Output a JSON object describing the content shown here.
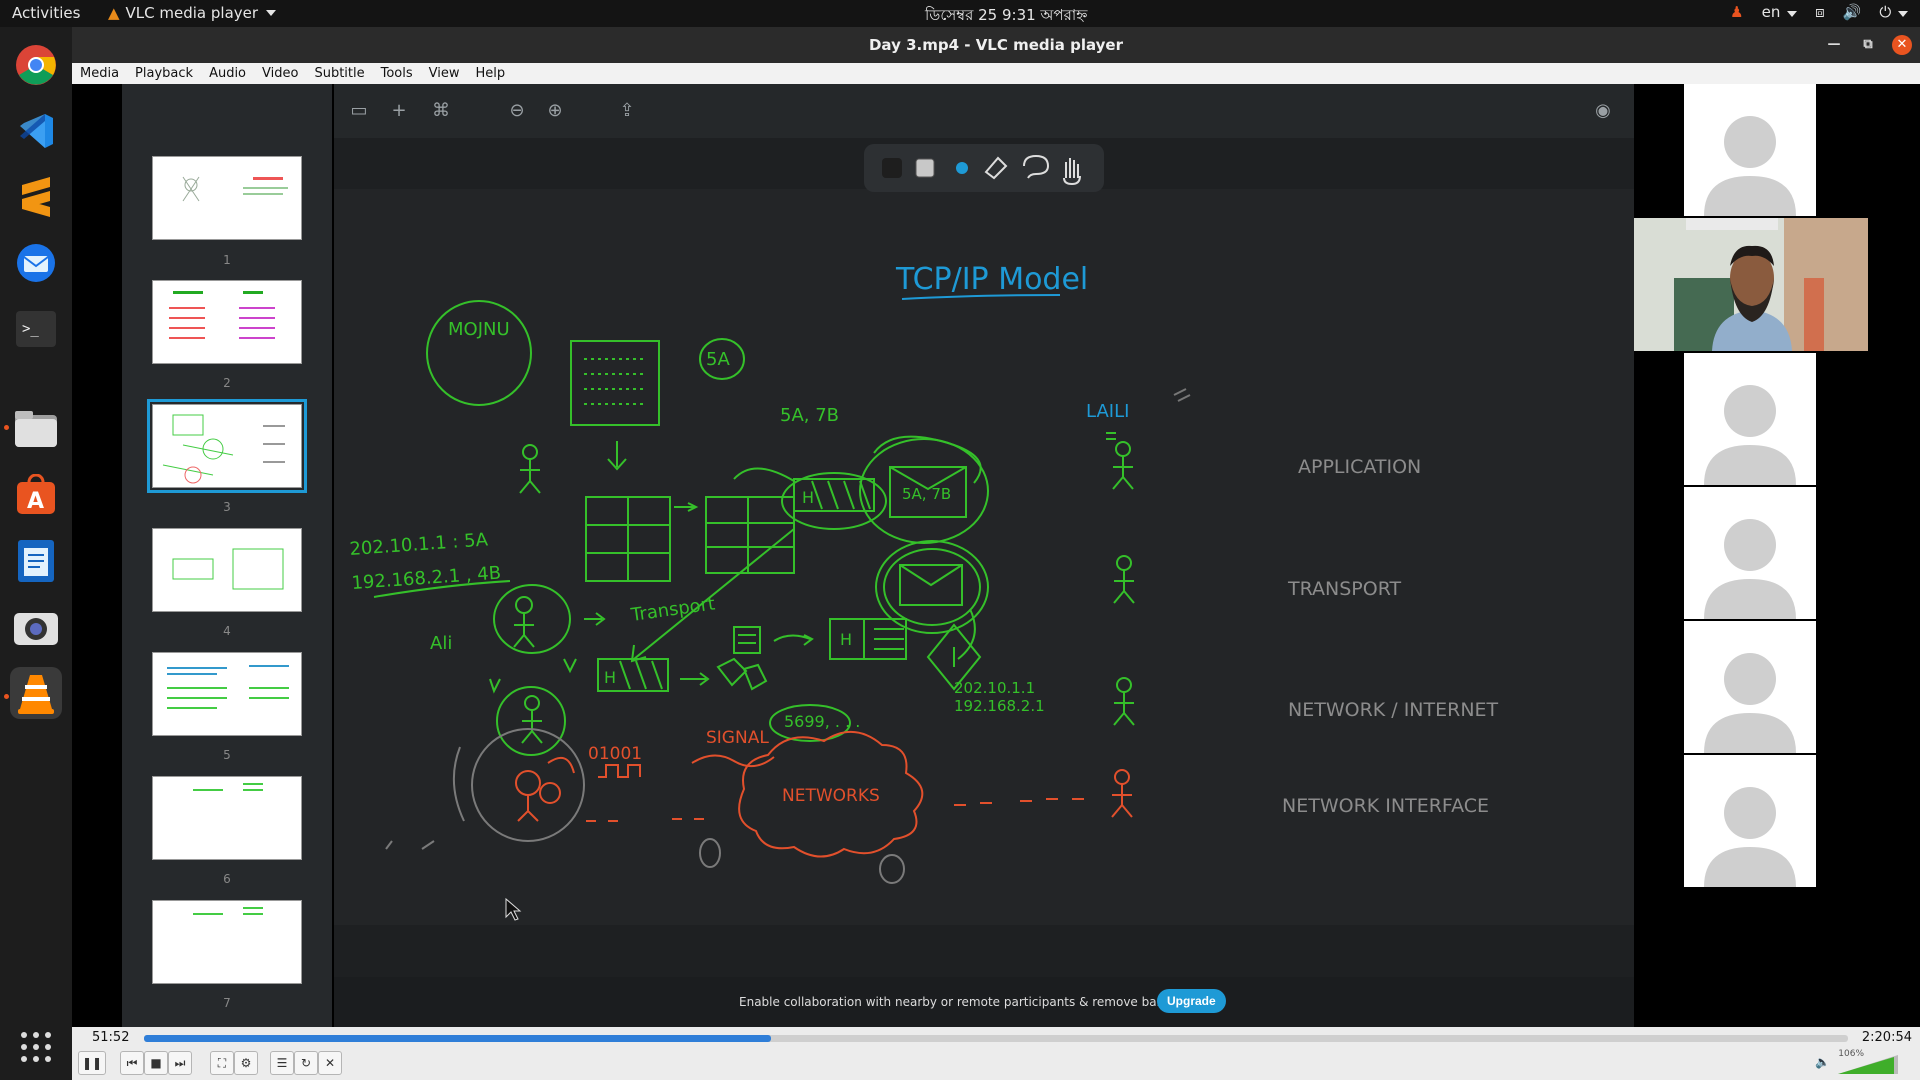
{
  "topbar": {
    "activities": "Activities",
    "app_name": "VLC media player",
    "clock": "ডিসেম্বর 25  9:31 অপরাহ্ন",
    "lang": "en"
  },
  "window": {
    "title": "Day 3.mp4 - VLC media player"
  },
  "menubar": [
    "Media",
    "Playback",
    "Audio",
    "Video",
    "Subtitle",
    "Tools",
    "View",
    "Help"
  ],
  "dock": {
    "items": [
      "chrome-icon",
      "vscode-icon",
      "sublime-icon",
      "thunderbird-icon",
      "terminal-icon",
      "files-icon",
      "software-icon",
      "writer-icon",
      "camera-icon",
      "vlc-icon",
      "app-grid-icon"
    ]
  },
  "slides": {
    "numbers": [
      "1",
      "2",
      "3",
      "4",
      "5",
      "6",
      "7"
    ],
    "selected_index": 2
  },
  "whiteboard": {
    "title": "TCP/IP Model",
    "names": {
      "left": "MOJNU",
      "right": "LAILI",
      "ali": "Ali"
    },
    "layers": [
      "APPLICATION",
      "TRANSPORT",
      "NETWORK / INTERNET",
      "NETWORK INTERFACE"
    ],
    "annotations": {
      "sa": "5A",
      "sa_tb": "5A, 7B",
      "sa_tb_env": "5A, 7B",
      "ip1": "202.10.1.1 : 5A",
      "ip2": "192.168.2.1 , 4B",
      "transport": "Transport",
      "port": "5699, . . .",
      "ip3": "202.10.1.1",
      "ip4": "192.168.2.1",
      "bits": "01001",
      "signal": "SIGNAL",
      "networks": "NETWORKS",
      "h": "H"
    },
    "banner": "Enable collaboration with nearby or remote participants & remove banner.",
    "upgrade": "Upgrade"
  },
  "colors": {
    "green": "#35c02a",
    "cyan": "#1e9ad6",
    "orange": "#e2502c",
    "gray_text": "#8c8c8c"
  },
  "player": {
    "elapsed": "51:52",
    "total": "2:20:54",
    "progress": 0.368,
    "volume": "106%"
  }
}
